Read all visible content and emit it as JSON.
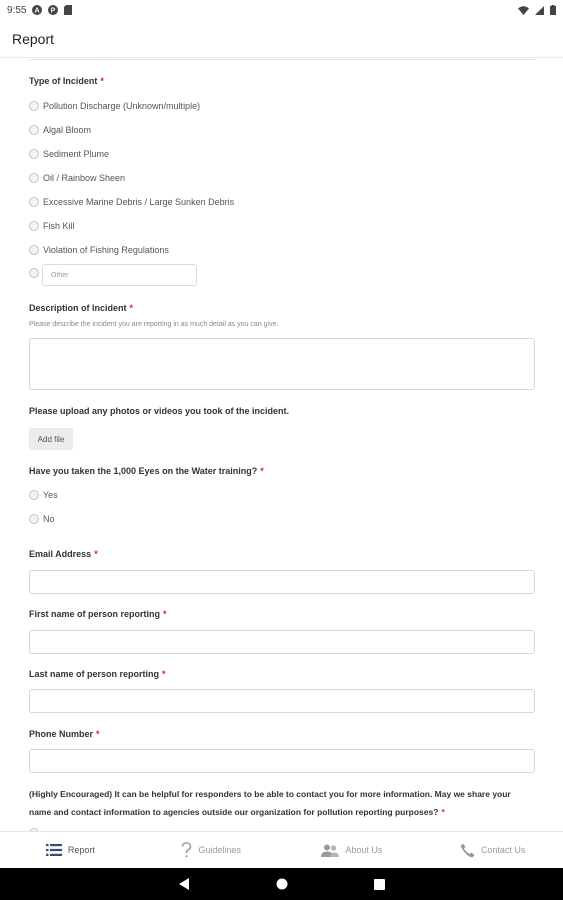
{
  "status_bar": {
    "time": "9:55"
  },
  "app_bar": {
    "title": "Report"
  },
  "incident_type": {
    "label": "Type of Incident",
    "required_mark": "*",
    "options": [
      "Pollution Discharge (Unknown/multiple)",
      "Algal Bloom",
      "Sediment Plume",
      "Oil / Rainbow Sheen",
      "Excessive Marine Debris / Large Sunken Debris",
      "Fish Kill",
      "Violation of Fishing Regulations"
    ],
    "other_placeholder": "Other"
  },
  "description": {
    "label": "Description of Incident",
    "required_mark": "*",
    "helper": "Please describe the incident you are reporting in as much detail as you can give."
  },
  "upload": {
    "label": "Please upload any photos or videos you took of the incident.",
    "button": "Add file"
  },
  "training": {
    "label": "Have you taken the 1,000 Eyes on the Water training?",
    "required_mark": "*",
    "options": [
      "Yes",
      "No"
    ]
  },
  "email": {
    "label": "Email Address",
    "required_mark": "*"
  },
  "first_name": {
    "label": "First name of person reporting",
    "required_mark": "*"
  },
  "last_name": {
    "label": "Last name of person reporting",
    "required_mark": "*"
  },
  "phone": {
    "label": "Phone Number",
    "required_mark": "*"
  },
  "share_consent": {
    "text": "(Highly Encouraged) It can be helpful for responders to be able to contact you for more information. May we share your name and contact information to agencies outside our organization for pollution reporting purposes?",
    "required_mark": "*"
  },
  "bottom_nav": {
    "items": [
      {
        "label": "Report",
        "icon": "list-icon"
      },
      {
        "label": "Guidelines",
        "icon": "question-icon"
      },
      {
        "label": "About Us",
        "icon": "people-icon"
      },
      {
        "label": "Contact Us",
        "icon": "phone-icon"
      }
    ]
  }
}
